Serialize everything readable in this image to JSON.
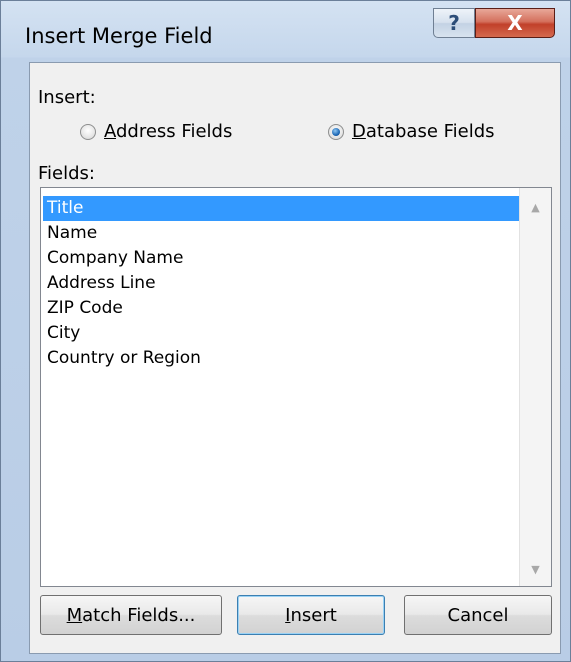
{
  "window": {
    "title": "Insert Merge Field",
    "help_glyph": "?",
    "close_glyph": "X"
  },
  "insert_group": {
    "label": "Insert:",
    "options": [
      {
        "label_first": "A",
        "label_rest": "ddress Fields",
        "checked": false
      },
      {
        "label_first": "D",
        "label_rest": "atabase Fields",
        "checked": true
      }
    ]
  },
  "fields": {
    "label_first": "F",
    "label_rest": "ields:",
    "items": [
      "Title",
      "Name",
      "Company Name",
      "Address Line",
      "ZIP Code",
      "City",
      "Country or Region"
    ],
    "selected_index": 0
  },
  "scrollbar": {
    "up_glyph": "▲",
    "down_glyph": "▼"
  },
  "buttons": {
    "match_first": "M",
    "match_rest": "atch Fields...",
    "insert_first": "I",
    "insert_rest": "nsert",
    "cancel": "Cancel"
  },
  "colors": {
    "selection": "#3399ff",
    "close_button": "#c1402a",
    "default_button_border": "#3c7fb1"
  }
}
